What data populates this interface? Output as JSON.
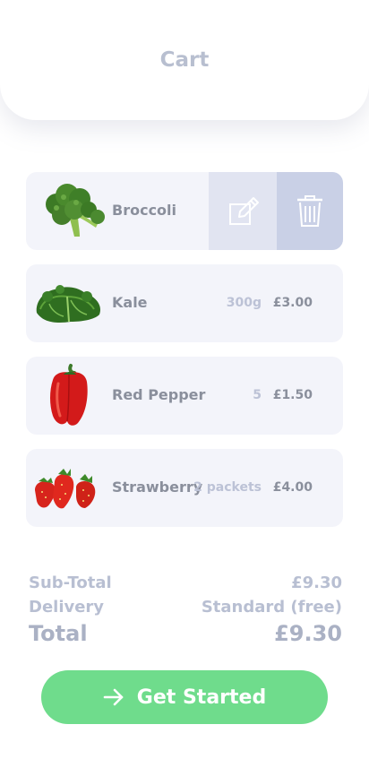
{
  "header": {
    "title": "Cart"
  },
  "cart": {
    "items": [
      {
        "name": "Broccoli",
        "qty": "",
        "price": ""
      },
      {
        "name": "Kale",
        "qty": "300g",
        "price": "£3.00"
      },
      {
        "name": "Red Pepper",
        "qty": "5",
        "price": "£1.50"
      },
      {
        "name": "Strawberry",
        "qty": "2 packets",
        "price": "£4.00"
      }
    ],
    "swipe_actions": {
      "edit_icon": "edit-icon",
      "delete_icon": "trash-icon"
    }
  },
  "summary": {
    "subtotal_label": "Sub-Total",
    "subtotal_value": "£9.30",
    "delivery_label": "Delivery",
    "delivery_value": "Standard (free)",
    "total_label": "Total",
    "total_value": "£9.30"
  },
  "cta": {
    "label": "Get Started",
    "icon": "arrow-right-icon"
  },
  "colors": {
    "accent": "#6fdc8c",
    "card_bg": "#f3f4fa",
    "edit_bg": "#e1e4f1",
    "delete_bg": "#c9d0e6"
  }
}
